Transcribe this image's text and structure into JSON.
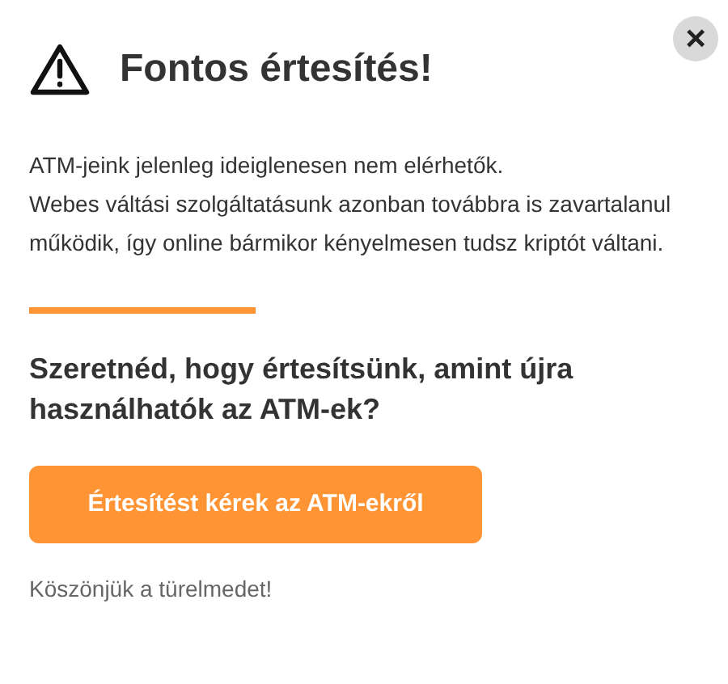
{
  "close_button": {
    "label": "×"
  },
  "title": "Fontos értesítés!",
  "message": [
    "ATM-jeink jelenleg ideiglenesen nem elérhetők.",
    "Webes váltási szolgáltatásunk azonban továbbra is zavartalanul működik, így online bármikor kényelmesen tudsz kriptót váltani."
  ],
  "question": "Szeretnéd, hogy értesítsünk, amint újra használhatók az ATM-ek?",
  "button": {
    "label": "Értesítést kérek az ATM-ekről"
  },
  "footer": "Köszönjük a türelmedet!"
}
